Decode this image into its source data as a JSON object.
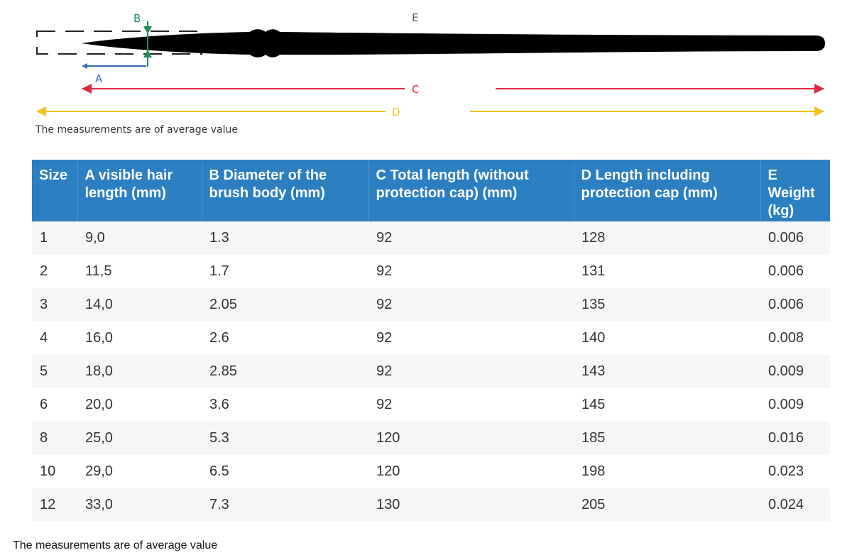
{
  "diagram": {
    "labels": {
      "a": "A",
      "b": "B",
      "c": "C",
      "d": "D",
      "e": "E"
    },
    "colors": {
      "a": "#3a6db5",
      "b": "#1f8f5a",
      "c": "#dc2a3c",
      "d": "#f3c21e",
      "brush": "#000000",
      "dashed_box": "#222222"
    }
  },
  "note_top": "The measurements are of average value",
  "table": {
    "header_color": "#2b7fc1",
    "headers": [
      "Size",
      "A visible hair length (mm)",
      "B Diameter of the brush body (mm)",
      "C Total length (without protection cap) (mm)",
      "D Length including protection cap (mm)",
      "E Weight (kg)"
    ],
    "rows": [
      [
        "1",
        "9,0",
        "1.3",
        "92",
        "128",
        "0.006"
      ],
      [
        "2",
        "11,5",
        "1.7",
        "92",
        "131",
        "0.006"
      ],
      [
        "3",
        "14,0",
        "2.05",
        "92",
        "135",
        "0.006"
      ],
      [
        "4",
        "16,0",
        "2.6",
        "92",
        "140",
        "0.008"
      ],
      [
        "5",
        "18,0",
        "2.85",
        "92",
        "143",
        "0.009"
      ],
      [
        "6",
        "20,0",
        "3.6",
        "92",
        "145",
        "0.009"
      ],
      [
        "8",
        "25,0",
        "5.3",
        "120",
        "185",
        "0.016"
      ],
      [
        "10",
        "29,0",
        "6.5",
        "120",
        "198",
        "0.023"
      ],
      [
        "12",
        "33,0",
        "7.3",
        "130",
        "205",
        "0.024"
      ]
    ]
  },
  "note_bottom": "The measurements are of average value"
}
